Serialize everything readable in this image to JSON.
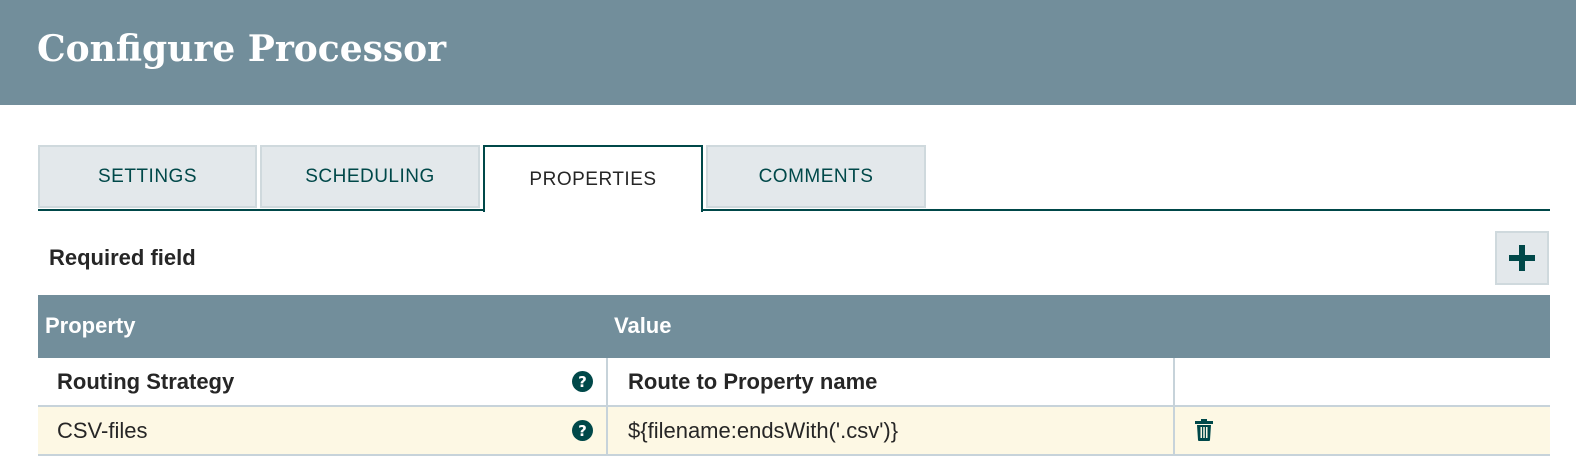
{
  "header": {
    "title": "Configure Processor"
  },
  "tabs": [
    {
      "label": "SETTINGS"
    },
    {
      "label": "SCHEDULING"
    },
    {
      "label": "PROPERTIES",
      "active": true
    },
    {
      "label": "COMMENTS"
    }
  ],
  "required_label": "Required field",
  "add_button": {
    "icon": "plus-icon"
  },
  "table": {
    "columns": [
      "Property",
      "Value"
    ],
    "rows": [
      {
        "property": "Routing Strategy",
        "value": "Route to Property name",
        "help_icon": "question-icon",
        "deletable": false
      },
      {
        "property": "CSV-files",
        "value": "${filename:endsWith('.csv')}",
        "help_icon": "question-icon",
        "deletable": true,
        "delete_icon": "trash-icon"
      }
    ]
  },
  "colors": {
    "header": "#728e9b",
    "accent": "#004849",
    "tab_bg": "#e3e8eb",
    "row_highlight": "#fdf8e4"
  }
}
